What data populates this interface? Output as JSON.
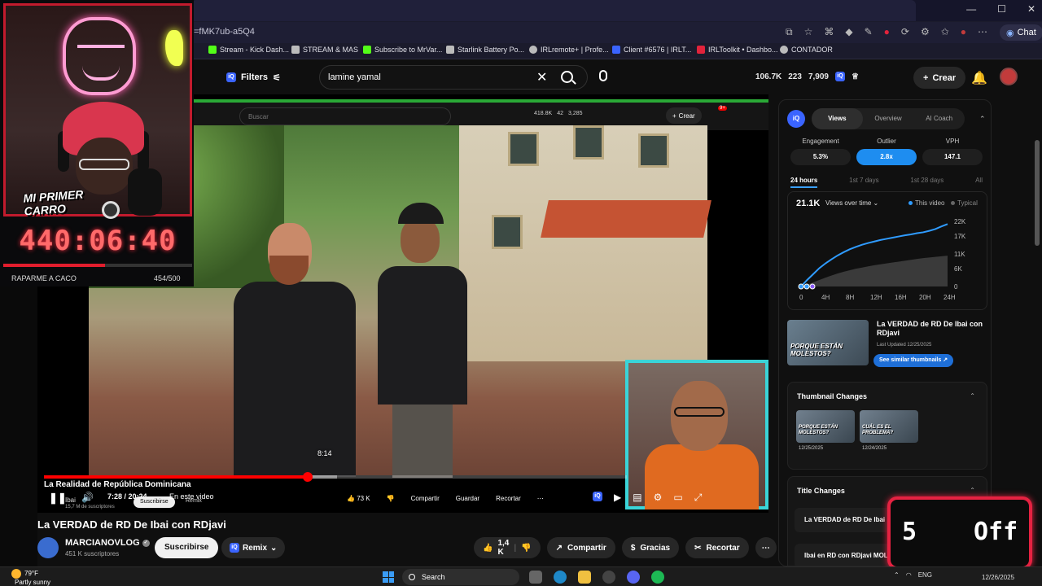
{
  "browser": {
    "url": "=fMK7ub-a5Q4",
    "copilot_label": "Chat",
    "window_controls": [
      "—",
      "☐",
      "✕"
    ]
  },
  "bookmarks": [
    {
      "label": "Stream - Kick Dash...",
      "color": "#53fc18"
    },
    {
      "label": "STREAM & MAS",
      "color": "#cccccc"
    },
    {
      "label": "Subscribe to MrVar...",
      "color": "#53fc18"
    },
    {
      "label": "Starlink Battery Po...",
      "color": "#cccccc"
    },
    {
      "label": "IRLremote+ | Profe...",
      "color": "#cccccc"
    },
    {
      "label": "Client #6576 | IRLT...",
      "color": "#3a64ff"
    },
    {
      "label": "IRLToolkit • Dashbo...",
      "color": "#e2233b"
    },
    {
      "label": "CONTADOR",
      "color": "#cccccc"
    }
  ],
  "header": {
    "filters_label": "Filters",
    "search_query": "lamine yamal",
    "stats": [
      "106.7K",
      "223",
      "7,909"
    ],
    "create_label": "Crear"
  },
  "overlay": {
    "promo_line1": "MI PRIMER",
    "promo_line2": "CARRO",
    "timer": "440:06:40",
    "goal_label": "RAPARME A CACO",
    "goal_count": "454/500",
    "goal_progress": 0.54
  },
  "inner_youtube": {
    "search_placeholder": "Buscar",
    "stats": [
      "418.8K",
      "42",
      "3,285"
    ],
    "create_label": "Crear",
    "notif_badge": "9+"
  },
  "player": {
    "hover_time": "8:14",
    "overlay_title": "La Realidad de República Dominicana",
    "time": "7:28 / 20:24",
    "chapter": "En este video",
    "channel_small": "Ibai",
    "subs_small": "15,7 M de suscriptores",
    "subscribe_small": "Suscribirse",
    "remix_small": "Remix",
    "likes_small": "73 K",
    "share_small": "Compartir",
    "save_small": "Guardar",
    "clip_small": "Recortar",
    "progress_played": 0.453,
    "progress_buffered": 0.503
  },
  "video": {
    "title": "La VERDAD de RD De Ibai con RDjavi",
    "channel": "MARCIANOVLOG",
    "subscribers": "451 K suscriptores",
    "subscribe_label": "Suscribirse",
    "remix_label": "Remix",
    "likes": "1,4 K",
    "share_label": "Compartir",
    "thanks_label": "Gracias",
    "clip_label": "Recortar"
  },
  "panel": {
    "tabs": [
      "Views",
      "Overview",
      "AI Coach"
    ],
    "active_tab": "Views",
    "metrics": [
      {
        "label": "Engagement",
        "value": "5.3%"
      },
      {
        "label": "Outlier",
        "value": "2.8x"
      },
      {
        "label": "VPH",
        "value": "147.1"
      }
    ],
    "ranges": [
      "24 hours",
      "1st 7 days",
      "1st 28 days",
      "All"
    ],
    "active_range": "24 hours",
    "views_total": "21.1K",
    "views_mode": "Views over time",
    "legend_this": "This video",
    "legend_typical": "Typical",
    "video_title": "La VERDAD de RD De Ibai con RDjavi",
    "last_updated": "Last Updated 12/25/2025",
    "thumb_text": "PORQUE ESTÁN MOLESTOS?",
    "similar_btn": "See similar thumbnails",
    "thumb_changes_title": "Thumbnail Changes",
    "thumb_changes": [
      {
        "text": "PORQUE ESTÁN MOLESTOS?",
        "date": "12/25/2025"
      },
      {
        "text": "CUÁL ES EL PROBLEMA?",
        "date": "12/24/2025"
      }
    ],
    "title_changes_title": "Title Changes",
    "title_changes": [
      "La VERDAD de RD De Ibai",
      "Ibai en RD con RDjavi MOL"
    ]
  },
  "chart_data": {
    "type": "line",
    "x": [
      0,
      1,
      2,
      3,
      4,
      5,
      6,
      7,
      8,
      9,
      10,
      11,
      12,
      13,
      14,
      15,
      16,
      17,
      18,
      19,
      20,
      21,
      22,
      23,
      24
    ],
    "x_ticks": [
      "0",
      "4H",
      "8H",
      "12H",
      "16H",
      "20H",
      "24H"
    ],
    "y_ticks": [
      "22K",
      "17K",
      "11K",
      "6K",
      "0"
    ],
    "ylim": [
      0,
      22000
    ],
    "xlim": [
      0,
      24
    ],
    "series": [
      {
        "name": "This video",
        "color": "#2f9bff",
        "values": [
          0,
          2200,
          4200,
          6200,
          7800,
          9200,
          10500,
          11600,
          12600,
          13400,
          14100,
          14700,
          15200,
          15700,
          16100,
          16500,
          16900,
          17300,
          17600,
          18000,
          18300,
          18800,
          19400,
          20300,
          21100
        ]
      },
      {
        "name": "Typical",
        "color": "#555555",
        "values": [
          0,
          600,
          1400,
          2200,
          3000,
          3700,
          4400,
          5000,
          5500,
          6000,
          6400,
          6800,
          7200,
          7500,
          7800,
          8100,
          8400,
          8700,
          9000,
          9300,
          9600,
          9800,
          10000,
          10200,
          10400
        ]
      }
    ]
  },
  "off_widget": {
    "count": "5",
    "label": "Off"
  },
  "taskbar": {
    "temp": "79°F",
    "condition": "Partly sunny",
    "search_label": "Search",
    "lang": "ENG",
    "date": "12/26/2025"
  }
}
